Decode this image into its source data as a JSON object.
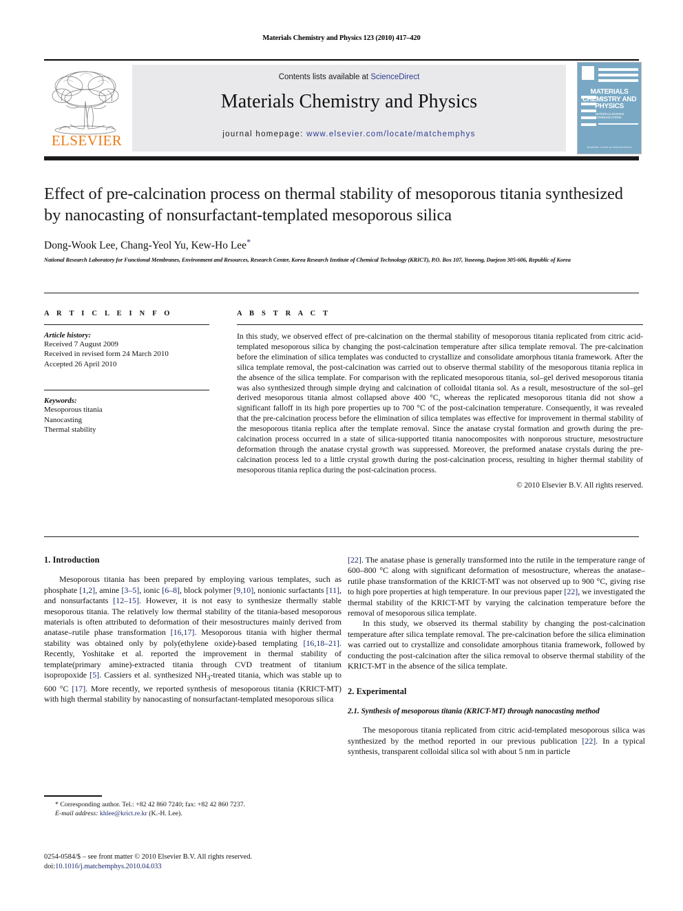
{
  "running_head": "Materials Chemistry and Physics 123 (2010) 417–420",
  "header": {
    "contents_prefix": "Contents lists available at ",
    "sciencedirect": "ScienceDirect",
    "journal_name": "Materials Chemistry and Physics",
    "homepage_label": "journal homepage: ",
    "homepage_url": "www.elsevier.com/locate/matchemphys",
    "publisher_logo_text": "ELSEVIER",
    "cover": {
      "title": "MATERIALS CHEMISTRY AND PHYSICS",
      "subtitle": "MATERIALS SCIENCE COMMUNICATIONS",
      "footer": "Available online at ScienceDirect"
    },
    "band_color": "#e9e9eb",
    "link_color": "#2b3a8f",
    "elsevier_orange": "#ec7b16",
    "cover_color": "#79a8c4"
  },
  "article": {
    "title": "Effect of pre-calcination process on thermal stability of mesoporous titania synthesized by nanocasting of nonsurfactant-templated mesoporous silica",
    "authors": "Dong-Wook Lee, Chang-Yeol Yu, Kew-Ho Lee",
    "corresponding_marker": "*",
    "affiliation": "National Research Laboratory for Functional Membranes, Environment and Resources, Research Center, Korea Research Institute of Chemical Technology (KRICT), P.O. Box 107, Yuseong, Daejeon 305-606, Republic of Korea"
  },
  "article_info": {
    "heading": "A R T I C L E   I N F O",
    "history_label": "Article history:",
    "history": [
      "Received 7 August 2009",
      "Received in revised form 24 March 2010",
      "Accepted 26 April 2010"
    ],
    "keywords_label": "Keywords:",
    "keywords": [
      "Mesoporous titania",
      "Nanocasting",
      "Thermal stability"
    ]
  },
  "abstract": {
    "heading": "A B S T R A C T",
    "text": "In this study, we observed effect of pre-calcination on the thermal stability of mesoporous titania replicated from citric acid-templated mesoporous silica by changing the post-calcination temperature after silica template removal. The pre-calcination before the elimination of silica templates was conducted to crystallize and consolidate amorphous titania framework. After the silica template removal, the post-calcination was carried out to observe thermal stability of the mesoporous titania replica in the absence of the silica template. For comparison with the replicated mesoporous titania, sol–gel derived mesoporous titania was also synthesized through simple drying and calcination of colloidal titania sol. As a result, mesostructure of the sol–gel derived mesoporous titania almost collapsed above 400 °C, whereas the replicated mesoporous titania did not show a significant falloff in its high pore properties up to 700 °C of the post-calcination temperature. Consequently, it was revealed that the pre-calcination process before the elimination of silica templates was effective for improvement in thermal stability of the mesoporous titania replica after the template removal. Since the anatase crystal formation and growth during the pre-calcination process occurred in a state of silica-supported titania nanocomposites with nonporous structure, mesostructure deformation through the anatase crystal growth was suppressed. Moreover, the preformed anatase crystals during the pre-calcination process led to a little crystal growth during the post-calcination process, resulting in higher thermal stability of mesoporous titania replica during the post-calcination process.",
    "copyright": "© 2010 Elsevier B.V. All rights reserved."
  },
  "body": {
    "intro_heading": "1.  Introduction",
    "intro_p1_a": "Mesoporous titania has been prepared by employing various templates, such as phosphate ",
    "intro_r1": "[1,2]",
    "intro_p1_b": ", amine ",
    "intro_r2": "[3–5]",
    "intro_p1_c": ", ionic ",
    "intro_r3": "[6–8]",
    "intro_p1_d": ", block polymer ",
    "intro_r4": "[9,10]",
    "intro_p1_e": ", nonionic surfactants ",
    "intro_r5": "[11]",
    "intro_p1_f": ", and nonsurfactants ",
    "intro_r6": "[12–15]",
    "intro_p1_g": ". However, it is not easy to synthesize thermally stable mesoporous titania. The relatively low thermal stability of the titania-based mesoporous materials is often attributed to deformation of their mesostructures mainly derived from anatase–rutile phase transformation ",
    "intro_r7": "[16,17]",
    "intro_p1_h": ". Mesoporous titania with higher thermal stability was obtained only by poly(ethylene oxide)-based templating ",
    "intro_r8": "[16,18–21]",
    "intro_p1_i": ". Recently, Yoshitake et al. reported the improvement in thermal stability of template(primary amine)-extracted titania through CVD treatment of titanium isopropoxide ",
    "intro_r9": "[5]",
    "intro_p1_j": ". Cassiers et al. synthesized NH",
    "intro_sub3": "3",
    "intro_p1_k": "-treated titania, which was stable up to 600 °C ",
    "intro_r10": "[17]",
    "intro_p1_l": ". More recently, we reported synthesis of mesoporous titania (KRICT-MT) with high thermal stability by nanocasting of nonsurfactant-templated mesoporous silica ",
    "right_r1": "[22]",
    "right_p1_a": ". The anatase phase is generally transformed into the rutile in the temperature range of 600–800 °C along with significant deformation of mesostructure, whereas the anatase–rutile phase transformation of the KRICT-MT was not observed up to 900 °C, giving rise to high pore properties at high temperature. In our previous paper ",
    "right_r2": "[22]",
    "right_p1_b": ", we investigated the thermal stability of the KRICT-MT by varying the calcination temperature before the removal of mesoporous silica template.",
    "right_p2": "In this study, we observed its thermal stability by changing the post-calcination temperature after silica template removal. The pre-calcination before the silica elimination was carried out to crystallize and consolidate amorphous titania framework, followed by conducting the post-calcination after the silica removal to observe thermal stability of the KRICT-MT in the absence of the silica template.",
    "exp_heading": "2.  Experimental",
    "exp_sub_heading": "2.1.  Synthesis of mesoporous titania (KRICT-MT) through nanocasting method",
    "exp_p1_a": "The mesoporous titania replicated from citric acid-templated mesoporous silica was synthesized by the method reported in our previous publication ",
    "exp_r1": "[22]",
    "exp_p1_b": ". In a typical synthesis, transparent colloidal silica sol with about 5 nm in particle"
  },
  "footer": {
    "corresponding": "* Corresponding author. Tel.: +82 42 860 7240; fax: +82 42 860 7237.",
    "email_label": "E-mail address:",
    "email": "khlee@krict.re.kr",
    "email_suffix": "(K.-H. Lee).",
    "imprint": "0254-0584/$ – see front matter © 2010 Elsevier B.V. All rights reserved.",
    "doi_label": "doi:",
    "doi": "10.1016/j.matchemphys.2010.04.033"
  }
}
